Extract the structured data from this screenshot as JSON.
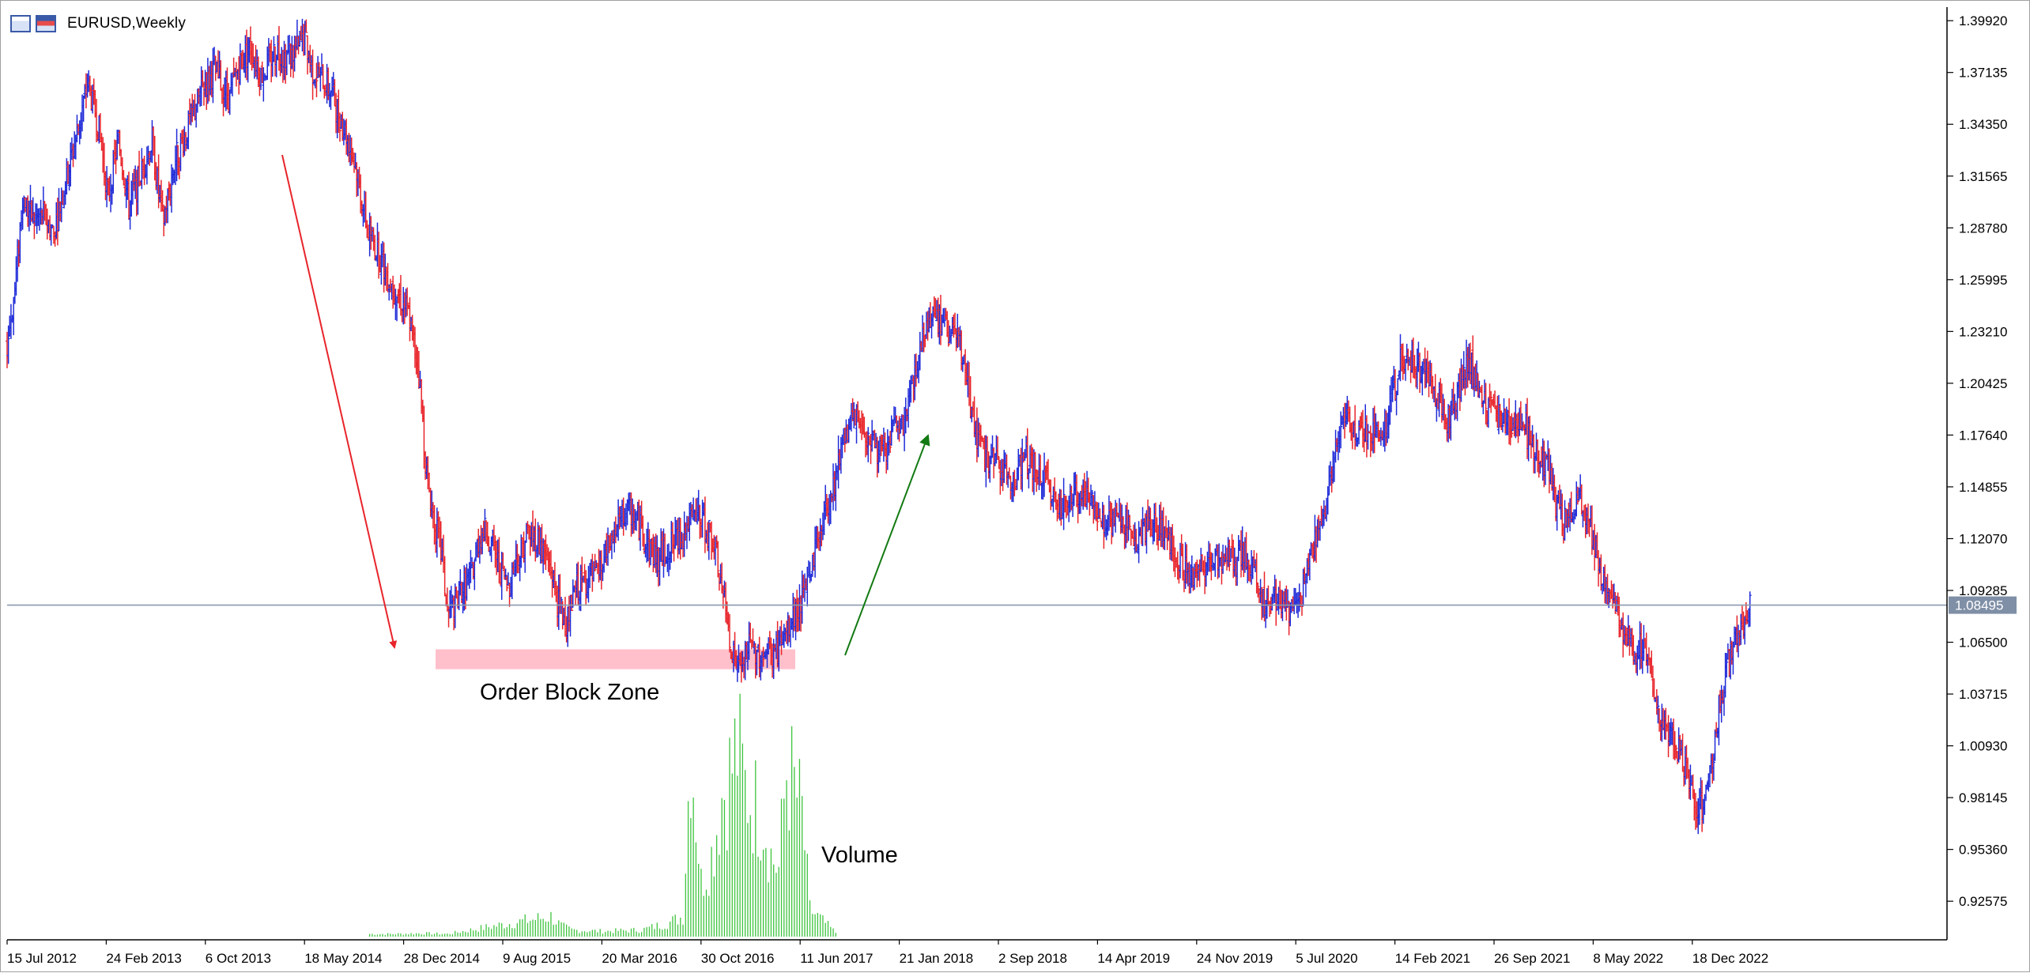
{
  "window": {
    "title": "EURUSD,Weekly",
    "icons": [
      "chart-window-icon",
      "chart-window-icon-active"
    ]
  },
  "colors": {
    "bull_bar": "#1f2bd8",
    "bear_bar": "#e8242a",
    "volume": "#3ec43e",
    "order_block": "#ffc0cb",
    "current_price_line": "#8a9aae",
    "price_tag_bg": "#7f8fa6",
    "down_arrow": "#e8242a",
    "up_arrow": "#127a12"
  },
  "annotations": {
    "order_block_label": "Order Block Zone",
    "volume_label": "Volume"
  },
  "chart_data": {
    "type": "ohlc",
    "symbol": "EURUSD",
    "timeframe": "Weekly",
    "y_ticks": [
      "1.39920",
      "1.37135",
      "1.34350",
      "1.31565",
      "1.28780",
      "1.25995",
      "1.23210",
      "1.20425",
      "1.17640",
      "1.14855",
      "1.12070",
      "1.09285",
      "1.06500",
      "1.03715",
      "1.00930",
      "0.98145",
      "0.95360",
      "0.92575"
    ],
    "ylim": [
      0.905,
      1.4065
    ],
    "current_price": "1.08495",
    "x_ticks": [
      "15 Jul 2012",
      "24 Feb 2013",
      "6 Oct 2013",
      "18 May 2014",
      "28 Dec 2014",
      "9 Aug 2015",
      "20 Mar 2016",
      "30 Oct 2016",
      "11 Jun 2017",
      "21 Jan 2018",
      "2 Sep 2018",
      "14 Apr 2019",
      "24 Nov 2019",
      "5 Jul 2020",
      "14 Feb 2021",
      "26 Sep 2021",
      "8 May 2022",
      "18 Dec 2022"
    ],
    "price_path": [
      [
        0,
        1.225
      ],
      [
        6,
        1.255
      ],
      [
        12,
        1.305
      ],
      [
        20,
        1.292
      ],
      [
        28,
        1.295
      ],
      [
        36,
        1.285
      ],
      [
        46,
        1.315
      ],
      [
        56,
        1.345
      ],
      [
        62,
        1.365
      ],
      [
        70,
        1.345
      ],
      [
        78,
        1.305
      ],
      [
        86,
        1.335
      ],
      [
        94,
        1.3
      ],
      [
        104,
        1.318
      ],
      [
        112,
        1.335
      ],
      [
        120,
        1.29
      ],
      [
        130,
        1.325
      ],
      [
        140,
        1.342
      ],
      [
        150,
        1.362
      ],
      [
        160,
        1.372
      ],
      [
        172,
        1.358
      ],
      [
        180,
        1.378
      ],
      [
        188,
        1.385
      ],
      [
        196,
        1.37
      ],
      [
        202,
        1.376
      ],
      [
        208,
        1.385
      ],
      [
        214,
        1.38
      ],
      [
        222,
        1.382
      ],
      [
        230,
        1.39
      ],
      [
        236,
        1.372
      ],
      [
        244,
        1.368
      ],
      [
        250,
        1.362
      ],
      [
        256,
        1.35
      ],
      [
        262,
        1.338
      ],
      [
        270,
        1.318
      ],
      [
        278,
        1.288
      ],
      [
        286,
        1.275
      ],
      [
        294,
        1.262
      ],
      [
        302,
        1.252
      ],
      [
        310,
        1.242
      ],
      [
        318,
        1.21
      ],
      [
        324,
        1.155
      ],
      [
        330,
        1.13
      ],
      [
        336,
        1.11
      ],
      [
        340,
        1.08
      ],
      [
        346,
        1.085
      ],
      [
        352,
        1.095
      ],
      [
        358,
        1.1
      ],
      [
        364,
        1.12
      ],
      [
        370,
        1.125
      ],
      [
        378,
        1.11
      ],
      [
        386,
        1.095
      ],
      [
        394,
        1.11
      ],
      [
        402,
        1.125
      ],
      [
        410,
        1.12
      ],
      [
        420,
        1.105
      ],
      [
        426,
        1.085
      ],
      [
        432,
        1.075
      ],
      [
        440,
        1.095
      ],
      [
        448,
        1.098
      ],
      [
        456,
        1.1
      ],
      [
        462,
        1.11
      ],
      [
        470,
        1.125
      ],
      [
        478,
        1.135
      ],
      [
        486,
        1.132
      ],
      [
        494,
        1.118
      ],
      [
        502,
        1.11
      ],
      [
        510,
        1.115
      ],
      [
        518,
        1.12
      ],
      [
        526,
        1.128
      ],
      [
        534,
        1.132
      ],
      [
        542,
        1.125
      ],
      [
        548,
        1.11
      ],
      [
        554,
        1.085
      ],
      [
        560,
        1.06
      ],
      [
        566,
        1.048
      ],
      [
        572,
        1.062
      ],
      [
        580,
        1.06
      ],
      [
        588,
        1.058
      ],
      [
        596,
        1.062
      ],
      [
        604,
        1.072
      ],
      [
        610,
        1.082
      ],
      [
        616,
        1.09
      ],
      [
        622,
        1.11
      ],
      [
        628,
        1.125
      ],
      [
        634,
        1.14
      ],
      [
        640,
        1.155
      ],
      [
        646,
        1.178
      ],
      [
        652,
        1.182
      ],
      [
        658,
        1.185
      ],
      [
        666,
        1.175
      ],
      [
        672,
        1.17
      ],
      [
        678,
        1.165
      ],
      [
        686,
        1.182
      ],
      [
        692,
        1.18
      ],
      [
        698,
        1.2
      ],
      [
        704,
        1.22
      ],
      [
        710,
        1.238
      ],
      [
        716,
        1.242
      ],
      [
        722,
        1.235
      ],
      [
        728,
        1.232
      ],
      [
        734,
        1.228
      ],
      [
        740,
        1.21
      ],
      [
        746,
        1.185
      ],
      [
        752,
        1.168
      ],
      [
        758,
        1.162
      ],
      [
        764,
        1.16
      ],
      [
        770,
        1.158
      ],
      [
        776,
        1.15
      ],
      [
        782,
        1.16
      ],
      [
        788,
        1.165
      ],
      [
        796,
        1.155
      ],
      [
        804,
        1.15
      ],
      [
        812,
        1.14
      ],
      [
        820,
        1.14
      ],
      [
        828,
        1.145
      ],
      [
        836,
        1.142
      ],
      [
        844,
        1.132
      ],
      [
        852,
        1.128
      ],
      [
        860,
        1.132
      ],
      [
        868,
        1.125
      ],
      [
        876,
        1.122
      ],
      [
        884,
        1.128
      ],
      [
        892,
        1.125
      ],
      [
        900,
        1.118
      ],
      [
        908,
        1.105
      ],
      [
        916,
        1.1
      ],
      [
        924,
        1.105
      ],
      [
        932,
        1.112
      ],
      [
        940,
        1.11
      ],
      [
        948,
        1.108
      ],
      [
        956,
        1.112
      ],
      [
        962,
        1.105
      ],
      [
        968,
        1.09
      ],
      [
        974,
        1.085
      ],
      [
        980,
        1.09
      ],
      [
        986,
        1.088
      ],
      [
        992,
        1.082
      ],
      [
        998,
        1.085
      ],
      [
        1004,
        1.105
      ],
      [
        1010,
        1.12
      ],
      [
        1016,
        1.135
      ],
      [
        1022,
        1.15
      ],
      [
        1028,
        1.175
      ],
      [
        1034,
        1.185
      ],
      [
        1040,
        1.182
      ],
      [
        1046,
        1.178
      ],
      [
        1052,
        1.18
      ],
      [
        1058,
        1.175
      ],
      [
        1064,
        1.182
      ],
      [
        1070,
        1.195
      ],
      [
        1076,
        1.215
      ],
      [
        1082,
        1.22
      ],
      [
        1088,
        1.215
      ],
      [
        1094,
        1.212
      ],
      [
        1100,
        1.205
      ],
      [
        1106,
        1.195
      ],
      [
        1112,
        1.185
      ],
      [
        1118,
        1.195
      ],
      [
        1124,
        1.21
      ],
      [
        1130,
        1.215
      ],
      [
        1136,
        1.205
      ],
      [
        1142,
        1.19
      ],
      [
        1148,
        1.188
      ],
      [
        1154,
        1.185
      ],
      [
        1160,
        1.18
      ],
      [
        1166,
        1.185
      ],
      [
        1172,
        1.182
      ],
      [
        1178,
        1.17
      ],
      [
        1184,
        1.165
      ],
      [
        1190,
        1.16
      ],
      [
        1196,
        1.14
      ],
      [
        1202,
        1.128
      ],
      [
        1208,
        1.135
      ],
      [
        1214,
        1.14
      ],
      [
        1220,
        1.135
      ],
      [
        1226,
        1.118
      ],
      [
        1232,
        1.098
      ],
      [
        1238,
        1.092
      ],
      [
        1244,
        1.08
      ],
      [
        1250,
        1.068
      ],
      [
        1256,
        1.06
      ],
      [
        1262,
        1.065
      ],
      [
        1268,
        1.058
      ],
      [
        1274,
        1.03
      ],
      [
        1280,
        1.015
      ],
      [
        1286,
        1.012
      ],
      [
        1292,
        1.005
      ],
      [
        1298,
        0.992
      ],
      [
        1304,
        0.98
      ],
      [
        1310,
        0.978
      ],
      [
        1316,
        0.995
      ],
      [
        1322,
        1.03
      ],
      [
        1328,
        1.05
      ],
      [
        1334,
        1.065
      ],
      [
        1340,
        1.075
      ],
      [
        1346,
        1.085
      ]
    ],
    "volume_path": [
      [
        280,
        0.004
      ],
      [
        300,
        0.004
      ],
      [
        320,
        0.005
      ],
      [
        340,
        0.004
      ],
      [
        420,
        0.03
      ],
      [
        428,
        0.016
      ],
      [
        436,
        0.01
      ],
      [
        460,
        0.008
      ],
      [
        490,
        0.01
      ],
      [
        510,
        0.02
      ],
      [
        522,
        0.03
      ],
      [
        528,
        0.29
      ],
      [
        536,
        0.08
      ],
      [
        544,
        0.12
      ],
      [
        552,
        0.21
      ],
      [
        558,
        0.24
      ],
      [
        564,
        0.28
      ],
      [
        570,
        0.22
      ],
      [
        576,
        0.2
      ],
      [
        584,
        0.18
      ],
      [
        590,
        0.12
      ],
      [
        596,
        0.1
      ],
      [
        602,
        0.25
      ],
      [
        608,
        0.22
      ],
      [
        614,
        0.18
      ],
      [
        620,
        0.04
      ],
      [
        640,
        0.006
      ]
    ]
  }
}
